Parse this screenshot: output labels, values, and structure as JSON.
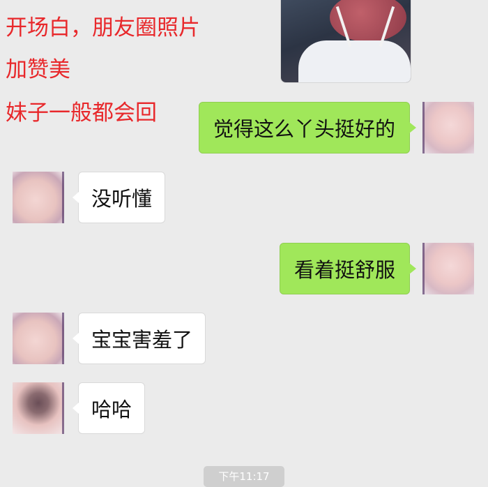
{
  "overlay_text": [
    "开场白，朋友圈照片",
    "加赞美",
    "妹子一般都会回"
  ],
  "messages": [
    {
      "side": "out",
      "text": "觉得这么丫头挺好的"
    },
    {
      "side": "in",
      "text": "没听懂"
    },
    {
      "side": "out",
      "text": "看着挺舒服"
    },
    {
      "side": "in",
      "text": "宝宝害羞了"
    },
    {
      "side": "in",
      "text": "哈哈"
    }
  ],
  "timestamp": "下午11:17",
  "colors": {
    "overlay_text": "#e8282b",
    "outgoing_bubble": "#a0e75a",
    "incoming_bubble": "#ffffff",
    "background": "#ebebeb"
  }
}
